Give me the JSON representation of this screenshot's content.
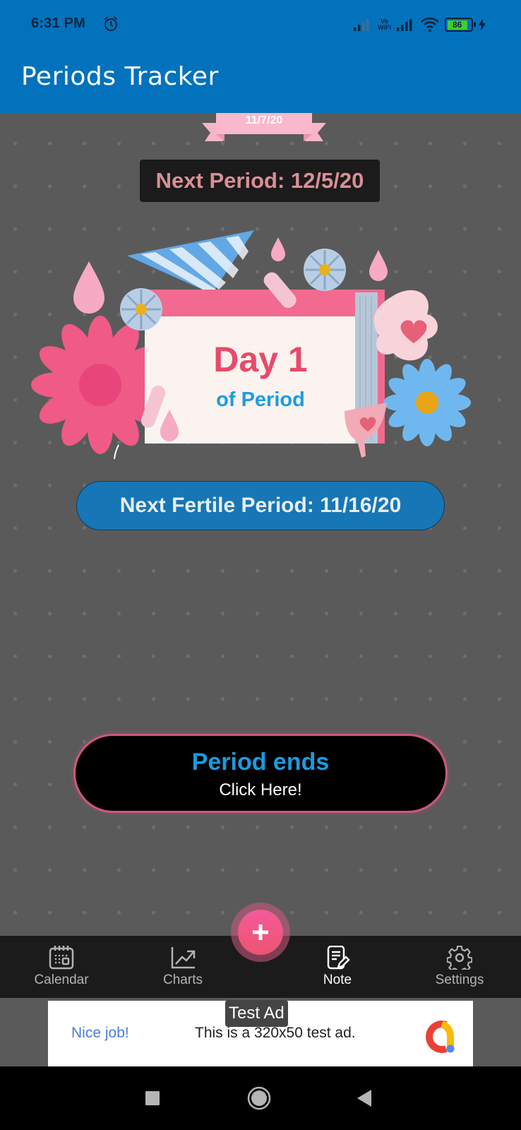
{
  "status_bar": {
    "time": "6:31 PM",
    "alarm_icon": "alarm-clock-icon",
    "vowifi_top": "Vo",
    "vowifi_bottom": "WiFi",
    "battery_level": "86",
    "charging_icon": "lightning-icon"
  },
  "app_bar": {
    "title": "Periods Tracker"
  },
  "main": {
    "current_date": "11/7/20",
    "next_period_label": "Next Period: 12/5/20",
    "day_title": "Day 1",
    "day_subtitle": "of Period",
    "next_fertile_label": "Next Fertile Period: 11/16/20",
    "period_ends_title": "Period ends",
    "period_ends_subtitle": "Click Here!"
  },
  "colors": {
    "app_bar": "#0272bd",
    "background": "#5a5a5a",
    "accent_pink": "#e84a6c",
    "accent_blue": "#1a9ce0",
    "fertile_pill": "#1776b5",
    "fab": "#f45a9b"
  },
  "bottom_nav": {
    "items": [
      {
        "label": "Calendar",
        "icon": "calendar-icon",
        "active": false
      },
      {
        "label": "Charts",
        "icon": "trending-chart-icon",
        "active": false
      },
      {
        "label": "Note",
        "icon": "note-edit-icon",
        "active": true
      },
      {
        "label": "Settings",
        "icon": "gear-icon",
        "active": false
      }
    ],
    "fab_icon": "plus-icon"
  },
  "ad": {
    "badge": "Test Ad",
    "headline": "Nice job!",
    "body": "This is a 320x50 test ad."
  },
  "system_nav": {
    "recents": "recents-square-icon",
    "home": "home-circle-icon",
    "back": "back-triangle-icon"
  }
}
